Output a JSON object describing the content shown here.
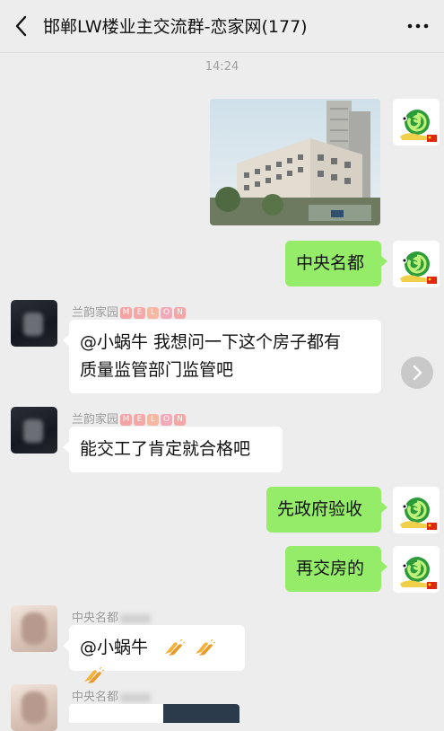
{
  "header": {
    "title": "邯郸LW楼业主交流群-恋家网(177)",
    "back_icon": "chevron-left-icon",
    "more_icon": "more-dots-icon"
  },
  "timestamp": "14:24",
  "members": {
    "lanyun": {
      "name": "兰韵家园",
      "badge": [
        "M",
        "E",
        "L",
        "O",
        "N"
      ]
    },
    "zhongyang": {
      "name": "中央名都"
    }
  },
  "messages": [
    {
      "side": "right",
      "type": "image",
      "description_icon": "building-photo"
    },
    {
      "side": "right",
      "text": "中央名都"
    },
    {
      "side": "left",
      "sender": "兰韵家园",
      "text_line1": "@小蜗牛  我想问一下这个房子都有",
      "text_line2": "质量监管部门监管吧"
    },
    {
      "side": "left",
      "sender": "兰韵家园",
      "text": "能交工了肯定就合格吧"
    },
    {
      "side": "right",
      "text": "先政府验收"
    },
    {
      "side": "right",
      "text": "再交房的"
    },
    {
      "side": "left",
      "sender": "中央名都",
      "text": "@小蜗牛"
    },
    {
      "side": "left",
      "sender": "中央名都",
      "text": ""
    }
  ],
  "colors": {
    "background": "#ededed",
    "bubble_self": "#95ec69",
    "bubble_other": "#ffffff",
    "timestamp": "#a0a0a0"
  }
}
